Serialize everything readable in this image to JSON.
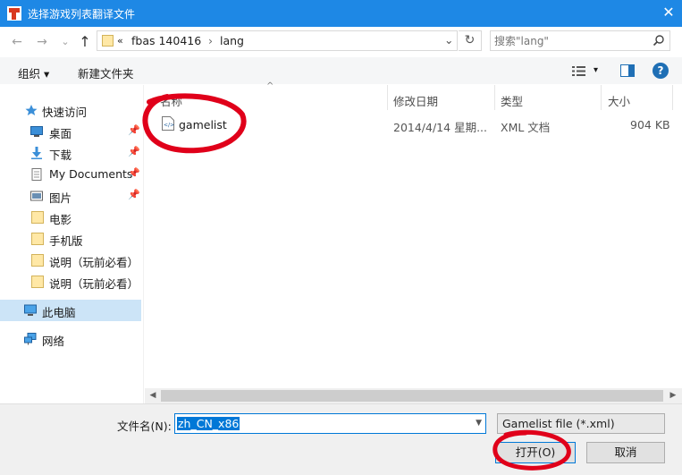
{
  "window": {
    "title": "选择游戏列表翻译文件",
    "close_glyph": "✕"
  },
  "nav_buttons": {
    "back": "←",
    "forward": "→",
    "down": "⌄",
    "up": "↑"
  },
  "address": {
    "overflow": "«",
    "segments": [
      "fbas 140416",
      "lang"
    ],
    "separator": "›",
    "dropdown": "⌄",
    "refresh": "↻"
  },
  "search": {
    "placeholder": "搜索\"lang\""
  },
  "toolbar": {
    "organize": "组织 ▾",
    "new_folder": "新建文件夹",
    "view_menu": "▾",
    "help": "?"
  },
  "sidebar": {
    "items": [
      {
        "label": "快速访问",
        "icon": "star-icon",
        "pinned": false
      },
      {
        "label": "桌面",
        "icon": "desktop-icon",
        "pinned": true
      },
      {
        "label": "下载",
        "icon": "download-icon",
        "pinned": true
      },
      {
        "label": "My Documents",
        "icon": "documents-icon",
        "pinned": true
      },
      {
        "label": "图片",
        "icon": "pictures-icon",
        "pinned": true
      },
      {
        "label": "电影",
        "icon": "folder-icon",
        "pinned": false
      },
      {
        "label": "手机版",
        "icon": "folder-icon",
        "pinned": false
      },
      {
        "label": "说明（玩前必看）",
        "icon": "folder-icon",
        "pinned": false
      },
      {
        "label": "说明（玩前必看）",
        "icon": "folder-icon",
        "pinned": false
      },
      {
        "label": "此电脑",
        "icon": "computer-icon",
        "pinned": false,
        "selected": true
      },
      {
        "label": "网络",
        "icon": "network-icon",
        "pinned": false
      }
    ],
    "pin_glyph": "📌"
  },
  "columns": [
    "名称",
    "修改日期",
    "类型",
    "大小"
  ],
  "files": [
    {
      "name": "gamelist",
      "modified": "2014/4/14 星期...",
      "type": "XML 文档",
      "size": "904 KB"
    }
  ],
  "scrollbar": {
    "left": "◀",
    "right": "▶"
  },
  "bottom": {
    "filename_label": "文件名(N):",
    "filename_value": "zh_CN_x86",
    "filter_value": "Gamelist file (*.xml)",
    "open_label": "打开(O)",
    "cancel_label": "取消"
  },
  "colors": {
    "titlebar": "#1e88e5",
    "selection": "#cce4f7",
    "annotation": "#e0001a"
  }
}
